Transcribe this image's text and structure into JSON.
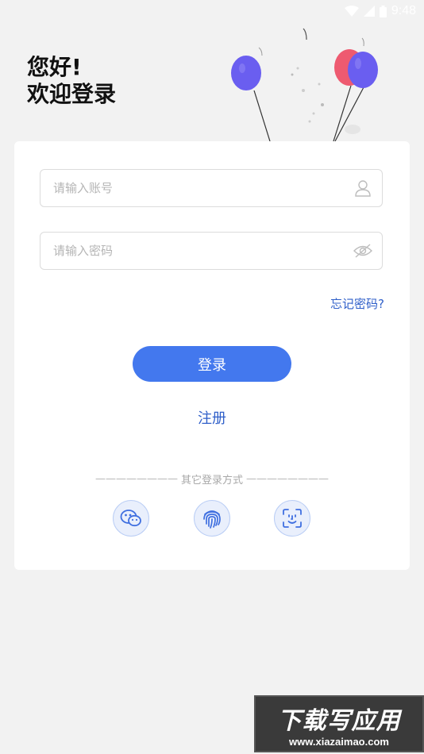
{
  "status_bar": {
    "time": "9:48"
  },
  "greeting": {
    "line1": "您好!",
    "line2": "欢迎登录"
  },
  "form": {
    "account_placeholder": "请输入账号",
    "password_placeholder": "请输入密码",
    "forgot_label": "忘记密码?",
    "login_label": "登录",
    "register_label": "注册"
  },
  "divider": {
    "dashes_left": "————————",
    "text": "其它登录方式",
    "dashes_right": "————————"
  },
  "alt_login": [
    "wechat-icon",
    "fingerprint-icon",
    "face-scan-icon"
  ],
  "colors": {
    "accent": "#4378ee",
    "link": "#2f5fc9",
    "background": "#f2f2f2"
  },
  "watermark": {
    "title": "下载写应用",
    "url": "www.xiazaimao.com"
  }
}
